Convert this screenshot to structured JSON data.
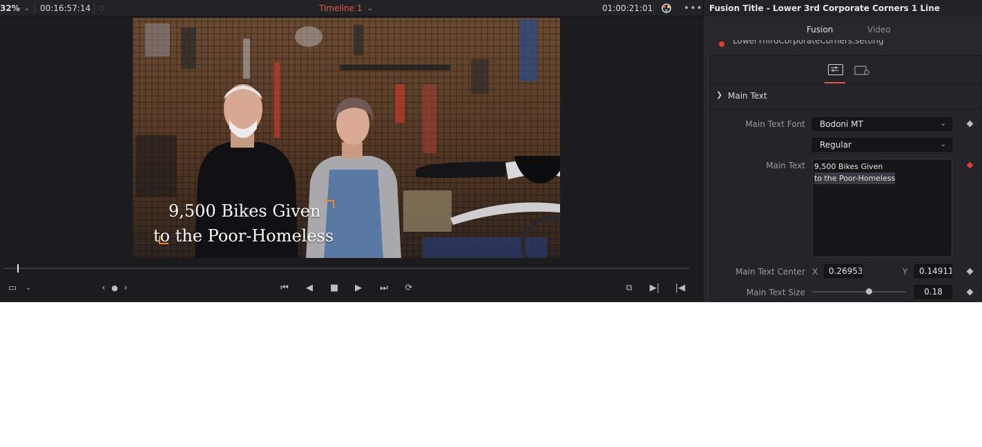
{
  "viewer": {
    "zoom_level": "32%",
    "timecode_duration": "00:16:57:14",
    "timeline_name": "Timeline 1",
    "timecode_current": "01:00:21:01",
    "playhead_fraction": 0.02
  },
  "video": {
    "title_line1": "9,500 Bikes Given",
    "title_line2": "to the Poor-Homeless",
    "corner_color": "#f08a24"
  },
  "inspector": {
    "title": "Fusion Title - Lower 3rd Corporate Corners 1 Line",
    "tabs": [
      "Fusion",
      "Video"
    ],
    "clip_name": "LowerThirdCorporateCorners.setting",
    "section": "Main Text",
    "fields": {
      "font_label": "Main Text Font",
      "font_value": "Bodoni MT",
      "style_value": "Regular",
      "text_label": "Main Text",
      "text_line1": "9,500 Bikes Given",
      "text_line2": "to the Poor-Homeless",
      "center_label": "Main Text Center",
      "center_x_label": "X",
      "center_x": "0.269537",
      "center_y_label": "Y",
      "center_y": "0.149113",
      "size_label": "Main Text Size",
      "size_value": "0.18",
      "size_fraction": 0.18
    }
  },
  "colors": {
    "accent": "#e9583f",
    "keyframe_active": "#d6402f"
  },
  "icons": {
    "transport": [
      "go-first-icon",
      "reverse-icon",
      "stop-icon",
      "play-icon",
      "go-last-icon",
      "loop-icon"
    ],
    "right": [
      "match-frame-icon",
      "next-edit-icon",
      "prev-edit-icon"
    ]
  }
}
